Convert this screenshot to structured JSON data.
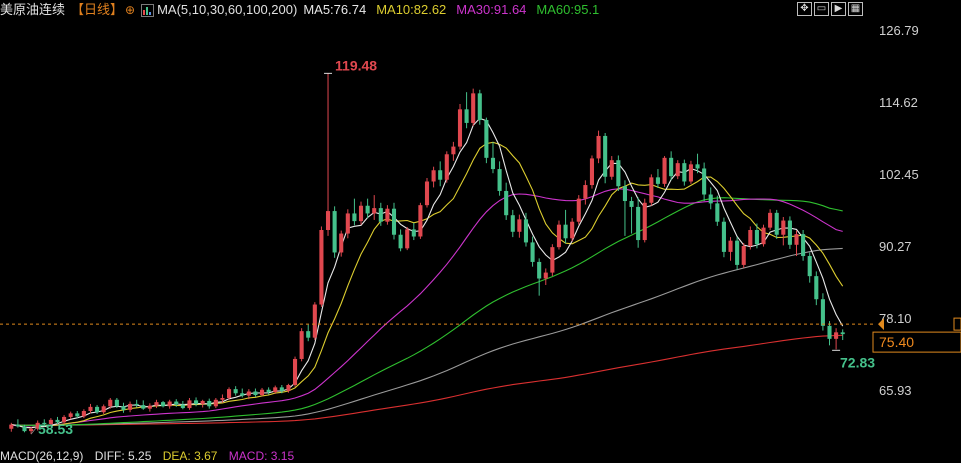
{
  "header": {
    "instrument": "美原油连续",
    "period": "【日线】",
    "ma_params": "MA(5,10,30,60,100,200)",
    "ma5": "MA5:76.74",
    "ma10": "MA10:82.62",
    "ma30": "MA30:91.64",
    "ma60": "MA60:95.1"
  },
  "toolbar": {
    "icons": [
      "move-icon",
      "window-icon",
      "play-icon",
      "layout-icon"
    ]
  },
  "macd_header": {
    "label": "MACD(26,12,9)",
    "diff": "DIFF: 5.25",
    "dea": "DEA: 3.67",
    "macd": "MACD: 3.15"
  },
  "colors": {
    "up": "#e0484f",
    "down": "#45c18b",
    "ma5": "#e8e8e8",
    "ma10": "#dccd2f",
    "ma30": "#cc34cc",
    "ma60": "#2fbf2f",
    "ma100": "#9a9a9a",
    "ma200": "#d93030",
    "price_line": "#e08a1e"
  },
  "chart_data": {
    "type": "candlestick",
    "y_ticks": [
      "126.79",
      "114.62",
      "102.45",
      "90.27",
      "78.10",
      "65.93"
    ],
    "ylim": [
      57.5,
      128.5
    ],
    "last_price": "75.40",
    "annotations": {
      "high": "119.48",
      "low": "58.53",
      "recent_low": "72.83"
    },
    "ohlc": [
      [
        59.4,
        60.4,
        58.9,
        60.1
      ],
      [
        60.1,
        61.0,
        59.6,
        59.8
      ],
      [
        59.8,
        60.1,
        58.8,
        59.0
      ],
      [
        59.0,
        59.7,
        58.5,
        59.4
      ],
      [
        59.4,
        60.8,
        59.1,
        60.4
      ],
      [
        60.4,
        61.0,
        59.8,
        60.2
      ],
      [
        60.2,
        61.2,
        59.9,
        60.9
      ],
      [
        60.9,
        61.4,
        60.2,
        60.5
      ],
      [
        60.5,
        61.7,
        60.2,
        61.4
      ],
      [
        61.4,
        62.3,
        61.0,
        62.0
      ],
      [
        62.0,
        62.4,
        61.2,
        61.5
      ],
      [
        61.5,
        62.7,
        61.2,
        62.4
      ],
      [
        62.4,
        63.6,
        62.0,
        63.1
      ],
      [
        63.1,
        63.4,
        61.9,
        62.2
      ],
      [
        62.2,
        63.5,
        61.9,
        63.2
      ],
      [
        63.2,
        64.6,
        62.8,
        64.3
      ],
      [
        64.3,
        64.6,
        62.9,
        63.2
      ],
      [
        63.2,
        63.8,
        62.1,
        62.6
      ],
      [
        62.6,
        64.0,
        62.2,
        63.6
      ],
      [
        63.6,
        64.3,
        63.0,
        63.4
      ],
      [
        63.4,
        64.2,
        62.6,
        62.8
      ],
      [
        62.8,
        63.7,
        62.3,
        63.3
      ],
      [
        63.3,
        64.3,
        62.9,
        63.9
      ],
      [
        63.9,
        64.1,
        63.0,
        63.2
      ],
      [
        63.2,
        64.3,
        62.8,
        64.0
      ],
      [
        64.0,
        64.4,
        63.1,
        63.5
      ],
      [
        63.5,
        64.1,
        62.7,
        62.9
      ],
      [
        62.9,
        64.6,
        62.6,
        64.2
      ],
      [
        64.2,
        64.7,
        63.2,
        63.6
      ],
      [
        63.6,
        64.3,
        63.0,
        64.1
      ],
      [
        64.1,
        64.5,
        62.8,
        63.2
      ],
      [
        63.2,
        64.6,
        62.9,
        64.3
      ],
      [
        64.3,
        65.2,
        63.8,
        64.6
      ],
      [
        64.6,
        66.4,
        64.3,
        66.1
      ],
      [
        66.1,
        66.6,
        65.0,
        65.4
      ],
      [
        65.4,
        66.2,
        64.7,
        65.0
      ],
      [
        65.0,
        66.1,
        64.4,
        65.7
      ],
      [
        65.7,
        66.2,
        64.8,
        65.1
      ],
      [
        65.1,
        66.3,
        64.9,
        66.0
      ],
      [
        66.0,
        66.4,
        65.2,
        65.6
      ],
      [
        65.6,
        66.7,
        65.3,
        66.4
      ],
      [
        66.4,
        66.8,
        65.4,
        65.8
      ],
      [
        65.8,
        67.0,
        65.5,
        66.8
      ],
      [
        66.8,
        71.6,
        66.5,
        71.2
      ],
      [
        71.2,
        76.4,
        70.8,
        75.9
      ],
      [
        75.9,
        77.0,
        74.2,
        74.8
      ],
      [
        74.8,
        80.8,
        74.4,
        80.4
      ],
      [
        80.4,
        93.6,
        80.0,
        93.0
      ],
      [
        93.0,
        119.48,
        92.0,
        96.2
      ],
      [
        96.2,
        97.0,
        88.3,
        89.2
      ],
      [
        89.2,
        92.9,
        88.5,
        92.4
      ],
      [
        92.4,
        96.5,
        91.6,
        95.8
      ],
      [
        95.8,
        98.3,
        93.8,
        94.5
      ],
      [
        94.5,
        97.8,
        93.9,
        97.1
      ],
      [
        97.1,
        98.3,
        95.0,
        95.8
      ],
      [
        95.8,
        98.9,
        94.7,
        96.7
      ],
      [
        96.7,
        97.6,
        93.7,
        94.4
      ],
      [
        94.4,
        97.2,
        93.9,
        96.6
      ],
      [
        96.6,
        97.6,
        91.4,
        92.2
      ],
      [
        92.2,
        93.1,
        89.4,
        89.9
      ],
      [
        89.9,
        93.5,
        89.6,
        93.1
      ],
      [
        93.1,
        94.2,
        91.3,
        91.9
      ],
      [
        91.9,
        97.6,
        91.5,
        97.2
      ],
      [
        97.2,
        101.8,
        96.8,
        101.2
      ],
      [
        101.2,
        103.7,
        100.2,
        103.1
      ],
      [
        103.1,
        104.6,
        100.4,
        101.5
      ],
      [
        101.5,
        106.3,
        101.0,
        105.8
      ],
      [
        105.8,
        107.9,
        104.7,
        107.1
      ],
      [
        107.1,
        114.3,
        106.6,
        113.4
      ],
      [
        113.4,
        116.3,
        110.2,
        111.1
      ],
      [
        111.1,
        116.9,
        110.6,
        116.1
      ],
      [
        116.1,
        116.7,
        110.8,
        111.6
      ],
      [
        111.6,
        112.0,
        104.3,
        105.2
      ],
      [
        105.2,
        107.9,
        102.6,
        103.3
      ],
      [
        103.3,
        104.6,
        98.8,
        99.6
      ],
      [
        99.6,
        101.0,
        94.7,
        95.5
      ],
      [
        95.5,
        96.4,
        91.8,
        92.7
      ],
      [
        92.7,
        95.6,
        91.7,
        94.8
      ],
      [
        94.8,
        95.9,
        90.2,
        90.9
      ],
      [
        90.9,
        91.9,
        86.8,
        87.6
      ],
      [
        87.6,
        88.2,
        81.9,
        84.8
      ],
      [
        84.8,
        86.5,
        83.7,
        85.8
      ],
      [
        85.8,
        90.6,
        85.2,
        90.1
      ],
      [
        90.1,
        94.6,
        89.7,
        93.9
      ],
      [
        93.9,
        96.4,
        90.7,
        91.6
      ],
      [
        91.6,
        95.0,
        91.1,
        94.4
      ],
      [
        94.4,
        98.9,
        93.9,
        98.3
      ],
      [
        98.3,
        101.4,
        97.3,
        100.6
      ],
      [
        100.6,
        105.6,
        100.0,
        105.1
      ],
      [
        105.1,
        109.8,
        104.3,
        108.9
      ],
      [
        108.9,
        109.4,
        100.9,
        102.0
      ],
      [
        102.0,
        105.5,
        101.5,
        104.8
      ],
      [
        104.8,
        105.6,
        99.6,
        100.4
      ],
      [
        100.4,
        101.4,
        92.0,
        97.9
      ],
      [
        97.9,
        98.6,
        92.4,
        96.9
      ],
      [
        96.9,
        98.5,
        90.0,
        91.3
      ],
      [
        91.3,
        98.3,
        90.9,
        97.6
      ],
      [
        97.6,
        102.4,
        97.1,
        101.9
      ],
      [
        101.9,
        103.3,
        100.1,
        100.8
      ],
      [
        100.8,
        105.5,
        100.3,
        105.2
      ],
      [
        105.2,
        106.3,
        101.4,
        102.1
      ],
      [
        102.1,
        104.8,
        101.6,
        104.3
      ],
      [
        104.3,
        104.9,
        100.5,
        101.2
      ],
      [
        101.2,
        104.7,
        100.8,
        104.1
      ],
      [
        104.1,
        105.9,
        102.6,
        103.4
      ],
      [
        103.4,
        104.4,
        97.9,
        99.0
      ],
      [
        99.0,
        100.2,
        96.5,
        97.5
      ],
      [
        97.5,
        98.8,
        93.7,
        94.4
      ],
      [
        94.4,
        95.1,
        88.4,
        89.3
      ],
      [
        89.3,
        91.8,
        87.8,
        91.2
      ],
      [
        91.2,
        91.8,
        86.3,
        87.1
      ],
      [
        87.1,
        90.8,
        86.6,
        90.3
      ],
      [
        90.3,
        93.6,
        89.7,
        93.0
      ],
      [
        93.0,
        94.1,
        89.9,
        90.6
      ],
      [
        90.6,
        93.9,
        90.2,
        93.4
      ],
      [
        93.4,
        96.5,
        93.0,
        95.9
      ],
      [
        95.9,
        96.4,
        91.5,
        92.2
      ],
      [
        92.2,
        95.2,
        90.4,
        94.6
      ],
      [
        94.6,
        95.3,
        89.8,
        90.5
      ],
      [
        90.5,
        92.9,
        88.6,
        92.3
      ],
      [
        92.3,
        93.0,
        87.8,
        88.6
      ],
      [
        88.6,
        89.2,
        84.1,
        85.2
      ],
      [
        85.2,
        86.0,
        80.3,
        81.3
      ],
      [
        81.3,
        82.3,
        76.0,
        76.8
      ],
      [
        76.8,
        77.6,
        73.5,
        74.6
      ],
      [
        74.6,
        76.4,
        72.83,
        75.7
      ],
      [
        75.7,
        76.2,
        74.4,
        75.4
      ]
    ]
  }
}
